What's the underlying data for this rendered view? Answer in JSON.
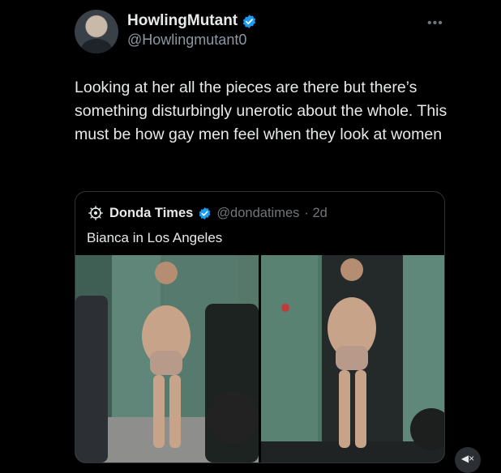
{
  "author": {
    "display_name": "HowlingMutant",
    "handle": "@Howlingmutant0",
    "verified": true,
    "avatar_icon": "avatar-photo"
  },
  "more_icon": "more-horizontal-icon",
  "tweet": {
    "text": "Looking at her all the pieces are there but there’s something disturbingly unerotic about the whole. This must be how gay men feel when they look at women"
  },
  "quote": {
    "display_name": "Donda Times",
    "handle": "@dondatimes",
    "age": "· 2d",
    "verified": true,
    "text": "Bianca in Los Angeles",
    "photo_count": 2
  },
  "colors": {
    "background": "#000000",
    "text_primary": "#e7e9ea",
    "text_secondary": "#71767b",
    "verified_blue": "#1d9bf0",
    "border": "#2f3336"
  }
}
